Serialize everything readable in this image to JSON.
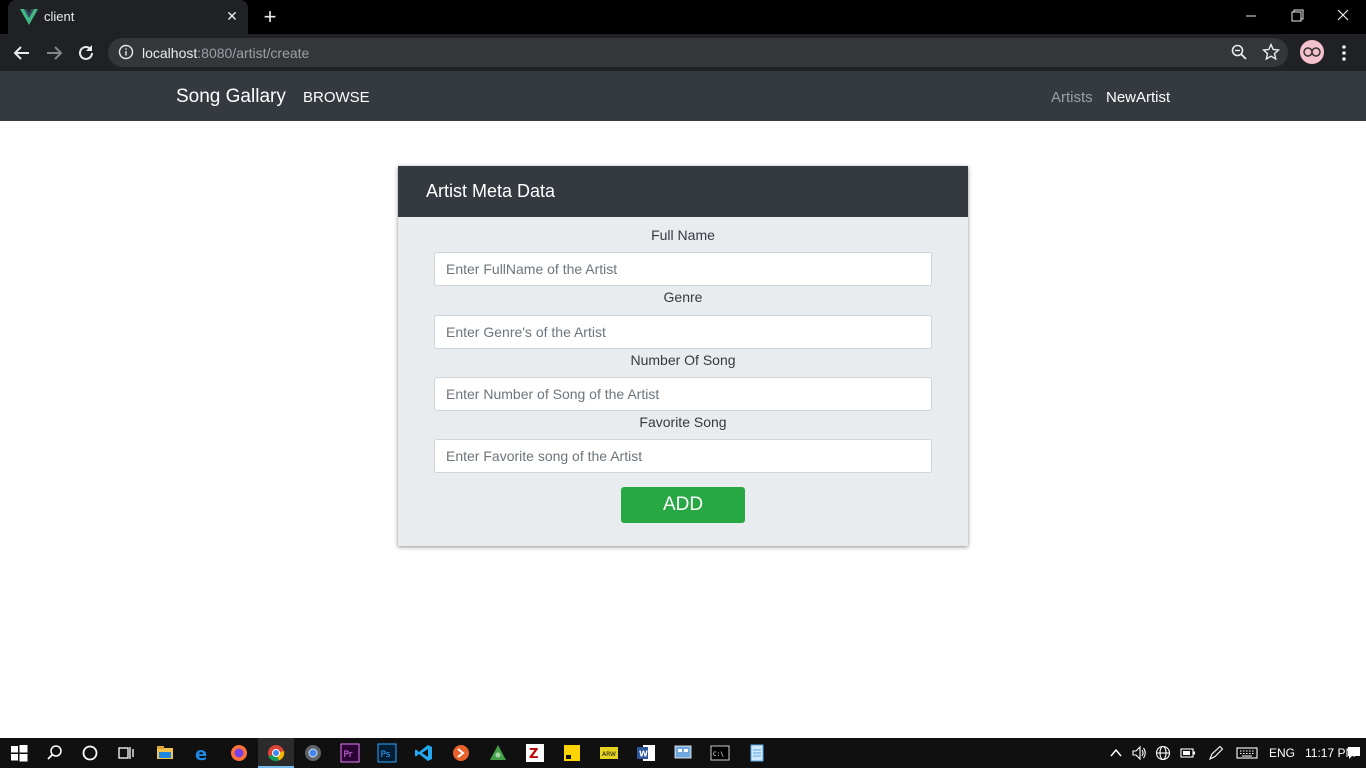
{
  "browser": {
    "tab_title": "client",
    "url_host": "localhost",
    "url_path": ":8080/artist/create"
  },
  "navbar": {
    "brand": "Song Gallary",
    "browse": "BROWSE",
    "links": [
      "Artists",
      "NewArtist"
    ]
  },
  "form": {
    "title": "Artist Meta Data",
    "fields": [
      {
        "label": "Full Name",
        "placeholder": "Enter FullName of the Artist",
        "value": ""
      },
      {
        "label": "Genre",
        "placeholder": "Enter Genre's of the Artist",
        "value": ""
      },
      {
        "label": "Number Of Song",
        "placeholder": "Enter Number of Song of the Artist",
        "value": ""
      },
      {
        "label": "Favorite Song",
        "placeholder": "Enter Favorite song of the Artist",
        "value": ""
      }
    ],
    "submit_label": "ADD"
  },
  "taskbar": {
    "language": "ENG",
    "time": "11:17 PM"
  },
  "colors": {
    "navbar_bg": "#343a40",
    "card_bg": "#e9ecef",
    "button_green": "#28a745"
  }
}
